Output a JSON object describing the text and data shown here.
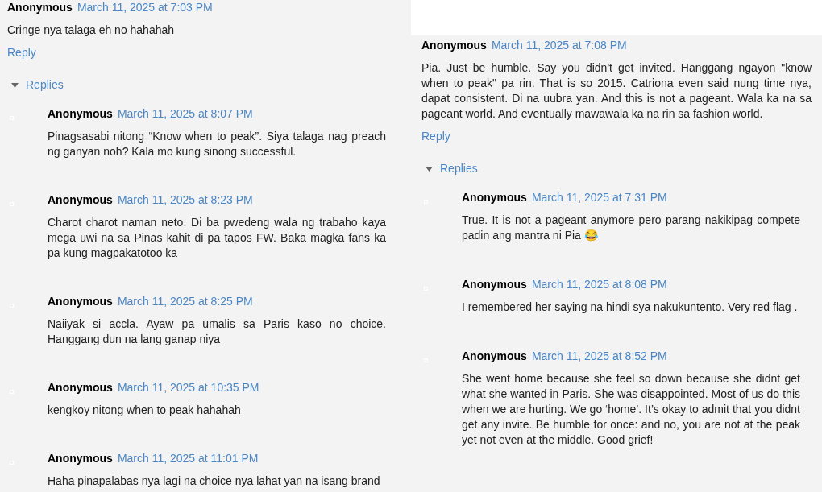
{
  "threads": [
    {
      "comment": {
        "author": "Anonymous",
        "date": "March 11, 2025 at 7:03 PM",
        "body": "Cringe nya talaga eh no hahahah",
        "reply_label": "Reply"
      },
      "replies_toggle": {
        "label": "Replies",
        "expanded": true
      },
      "replies": [
        {
          "author": "Anonymous",
          "date": "March 11, 2025 at 8:07 PM",
          "body": "Pinagsasabi nitong “Know when to peak”. Siya talaga nag preach ng ganyan noh? Kala mo kung sinong successful."
        },
        {
          "author": "Anonymous",
          "date": "March 11, 2025 at 8:23 PM",
          "body": "Charot charot naman neto. Di ba pwedeng wala ng trabaho kaya mega uwi na sa Pinas kahit di pa tapos FW. Baka magka fans ka pa kung magpakatotoo ka"
        },
        {
          "author": "Anonymous",
          "date": "March 11, 2025 at 8:25 PM",
          "body": "Naiiyak si accla. Ayaw pa umalis sa Paris kaso no choice. Hanggang dun na lang ganap niya"
        },
        {
          "author": "Anonymous",
          "date": "March 11, 2025 at 10:35 PM",
          "body": "kengkoy nitong when to peak hahahah"
        },
        {
          "author": "Anonymous",
          "date": "March 11, 2025 at 11:01 PM",
          "body": "Haha pinapalabas nya lagi na choice nya lahat yan na isang brand"
        }
      ]
    },
    {
      "comment": {
        "author": "Anonymous",
        "date": "March 11, 2025 at 7:08 PM",
        "body": "Pia. Just be humble. Say you didn't get invited. Hanggang ngayon \"know when to peak\" pa rin. That is so 2015. Catriona even said nung time nya, dapat consistent. Di na uubra yan. And this is not a pageant. Wala ka na sa pageant world. And eventually mawawala ka na rin sa fashion world.",
        "reply_label": "Reply"
      },
      "replies_toggle": {
        "label": "Replies",
        "expanded": true
      },
      "replies": [
        {
          "author": "Anonymous",
          "date": "March 11, 2025 at 7:31 PM",
          "body": "True. It is not a pageant anymore pero parang nakikipag compete padin ang mantra ni Pia 😂"
        },
        {
          "author": "Anonymous",
          "date": "March 11, 2025 at 8:08 PM",
          "body": "I remembered her saying na hindi sya nakukuntento. Very red flag ."
        },
        {
          "author": "Anonymous",
          "date": "March 11, 2025 at 8:52 PM",
          "body": "She went home because she feel so down because she didnt get what she wanted in Paris. She was disappointed. Most of us do this when we are hurting. We go ‘home’. It’s okay to admit that you didnt get any invite. Be humble for once: and no, you are not at the peak yet not even at the middle. Good grief!"
        }
      ]
    }
  ]
}
